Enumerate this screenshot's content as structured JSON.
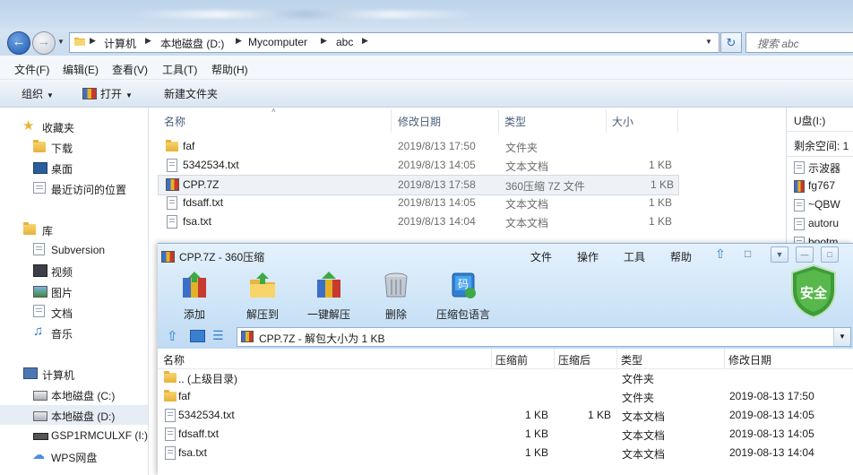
{
  "explorer": {
    "breadcrumbs": [
      "计算机",
      "本地磁盘 (D:)",
      "Mycomputer",
      "abc"
    ],
    "search_placeholder": "搜索 abc",
    "menu": [
      "文件(F)",
      "编辑(E)",
      "查看(V)",
      "工具(T)",
      "帮助(H)"
    ],
    "toolbar": {
      "organize": "组织",
      "open": "打开",
      "new_folder": "新建文件夹"
    },
    "nav": {
      "favorites": {
        "header": "收藏夹",
        "items": [
          "下载",
          "桌面",
          "最近访问的位置"
        ]
      },
      "libraries": {
        "header": "库",
        "items": [
          "Subversion",
          "视频",
          "图片",
          "文档",
          "音乐"
        ]
      },
      "computer": {
        "header": "计算机",
        "items": [
          "本地磁盘 (C:)",
          "本地磁盘 (D:)",
          "GSP1RMCULXF (I:)",
          "WPS网盘"
        ]
      }
    },
    "columns": [
      "名称",
      "修改日期",
      "类型",
      "大小"
    ],
    "files": [
      {
        "name": "faf",
        "modified": "2019/8/13 17:50",
        "type": "文件夹",
        "size": "",
        "icon": "folder-icon"
      },
      {
        "name": "5342534.txt",
        "modified": "2019/8/13 14:05",
        "type": "文本文档",
        "size": "1 KB",
        "icon": "text-file-icon"
      },
      {
        "name": "CPP.7Z",
        "modified": "2019/8/13 17:58",
        "type": "360压缩 7Z 文件",
        "size": "1 KB",
        "icon": "archive-icon"
      },
      {
        "name": "fdsaff.txt",
        "modified": "2019/8/13 14:05",
        "type": "文本文档",
        "size": "1 KB",
        "icon": "text-file-icon"
      },
      {
        "name": "fsa.txt",
        "modified": "2019/8/13 14:04",
        "type": "文本文档",
        "size": "1 KB",
        "icon": "text-file-icon"
      }
    ],
    "preview": {
      "title": "U盘(I:)",
      "free": "剩余空间: 1",
      "items": [
        "示波器",
        "fg767",
        "~QBW",
        "autoru",
        "bootm"
      ]
    }
  },
  "archive": {
    "title": "CPP.7Z - 360压缩",
    "menu": [
      "文件",
      "操作",
      "工具",
      "帮助"
    ],
    "buttons": [
      "添加",
      "解压到",
      "一键解压",
      "删除",
      "压缩包语言"
    ],
    "safe_badge": "安全",
    "path": "CPP.7Z - 解包大小为 1 KB",
    "columns": [
      "名称",
      "压缩前",
      "压缩后",
      "类型",
      "修改日期"
    ],
    "rows": [
      {
        "name": ".. (上级目录)",
        "before": "",
        "after": "",
        "type": "文件夹",
        "modified": "",
        "icon": "folder-icon"
      },
      {
        "name": "faf",
        "before": "",
        "after": "",
        "type": "文件夹",
        "modified": "2019-08-13 17:50",
        "icon": "folder-icon"
      },
      {
        "name": "5342534.txt",
        "before": "1 KB",
        "after": "1 KB",
        "type": "文本文档",
        "modified": "2019-08-13 14:05",
        "icon": "text-file-icon"
      },
      {
        "name": "fdsaff.txt",
        "before": "1 KB",
        "after": "",
        "type": "文本文档",
        "modified": "2019-08-13 14:05",
        "icon": "text-file-icon"
      },
      {
        "name": "fsa.txt",
        "before": "1 KB",
        "after": "",
        "type": "文本文档",
        "modified": "2019-08-13 14:04",
        "icon": "text-file-icon"
      }
    ]
  }
}
